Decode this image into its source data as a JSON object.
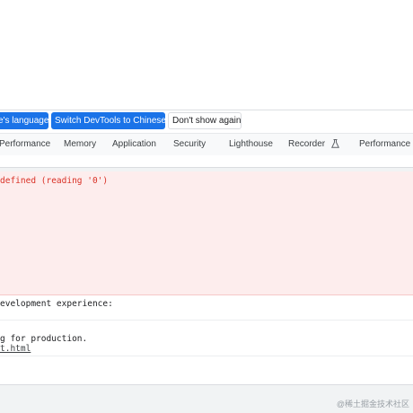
{
  "banner": {
    "language_button": "e's language",
    "switch_button": "Switch DevTools to Chinese",
    "dont_show_button": "Don't show again"
  },
  "tabs": [
    "Performance",
    "Memory",
    "Application",
    "Security",
    "Lighthouse",
    "Recorder",
    "Performance in"
  ],
  "console": {
    "error_text": "defined (reading '0')",
    "line1": "evelopment experience:",
    "line2": "g for production.",
    "line3": "t.html"
  },
  "watermark": "@稀土掘金技术社区",
  "colors": {
    "primary_button": "#1a73e8",
    "error_bg": "#fdeded",
    "error_text": "#d93025"
  }
}
